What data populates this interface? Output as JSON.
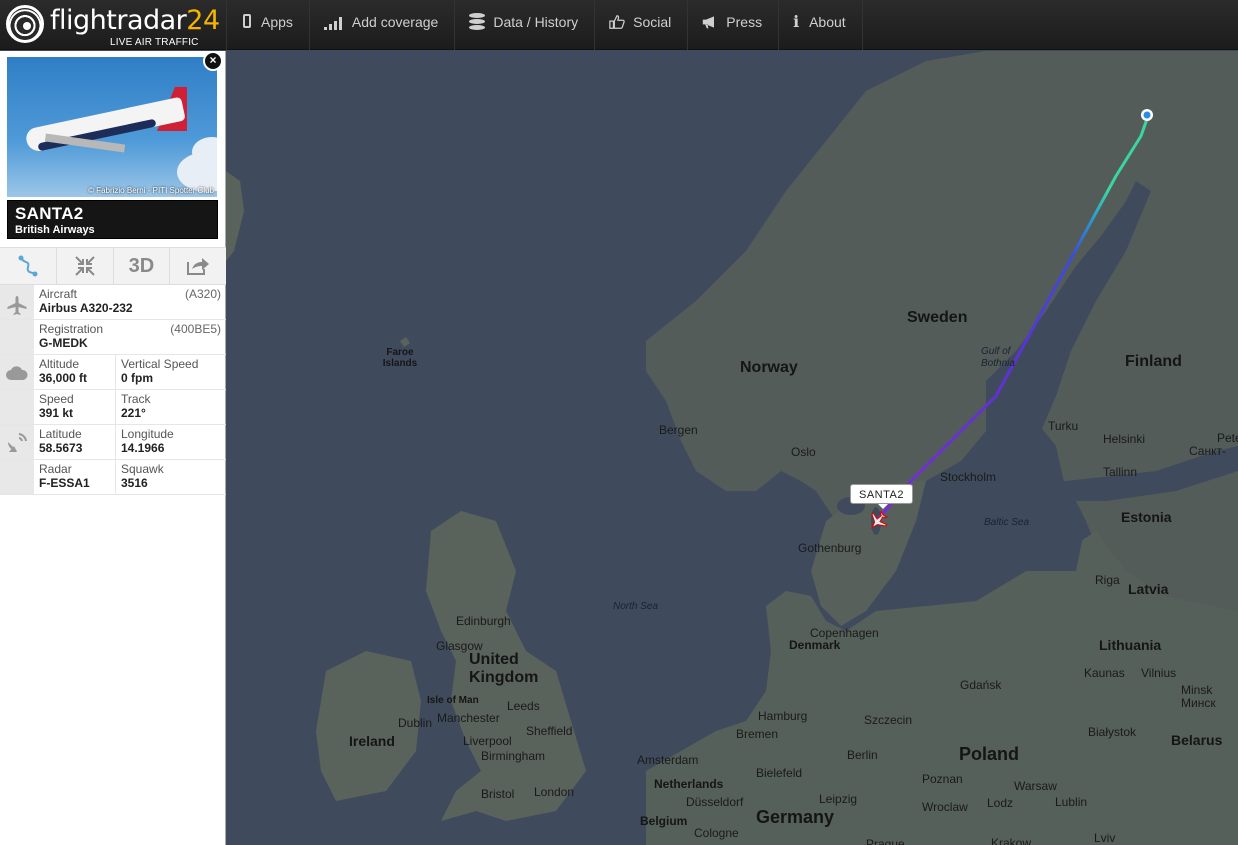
{
  "app": {
    "logo_text_main": "flightradar",
    "logo_text_accent": "24",
    "logo_sub": "LIVE AIR TRAFFIC"
  },
  "nav": [
    {
      "label": "Apps",
      "icon": "phone-icon"
    },
    {
      "label": "Add coverage",
      "icon": "signal-bars-icon"
    },
    {
      "label": "Data / History",
      "icon": "database-icon"
    },
    {
      "label": "Social",
      "icon": "thumbs-up-icon"
    },
    {
      "label": "Press",
      "icon": "megaphone-icon"
    },
    {
      "label": "About",
      "icon": "info-icon"
    }
  ],
  "flight": {
    "photo_credit": "© Fabrizio Berni - PITI Spotter Club",
    "callsign": "SANTA2",
    "airline": "British Airways",
    "tools": {
      "route": "route-icon",
      "collapse": "compress-icon",
      "three_d": "3D",
      "share": "share-icon"
    },
    "aircraft_label": "Aircraft",
    "aircraft_value": "Airbus A320-232",
    "aircraft_code": "(A320)",
    "registration_label": "Registration",
    "registration_value": "G-MEDK",
    "registration_code": "(400BE5)",
    "altitude_label": "Altitude",
    "altitude_value": "36,000 ft",
    "vspeed_label": "Vertical Speed",
    "vspeed_value": "0 fpm",
    "speed_label": "Speed",
    "speed_value": "391 kt",
    "track_label": "Track",
    "track_value": "221°",
    "latitude_label": "Latitude",
    "latitude_value": "58.5673",
    "longitude_label": "Longitude",
    "longitude_value": "14.1966",
    "radar_label": "Radar",
    "radar_value": "F-ESSA1",
    "squawk_label": "Squawk",
    "squawk_value": "3516"
  },
  "map": {
    "flight_tag": "SANTA2",
    "countries": [
      "Sweden",
      "Norway",
      "Finland",
      "Estonia",
      "Latvia",
      "Lithuania",
      "Denmark",
      "United Kingdom",
      "Ireland",
      "Poland",
      "Germany",
      "Belarus",
      "Belgium",
      "Netherlands"
    ],
    "cities": [
      "Bergen",
      "Oslo",
      "Stockholm",
      "Turku",
      "Helsinki",
      "Tallinn",
      "Gothenburg",
      "Riga",
      "Copenhagen",
      "Kaunas",
      "Vilnius",
      "Edinburgh",
      "Glasgow",
      "Leeds",
      "Manchester",
      "Liverpool",
      "Sheffield",
      "Dublin",
      "Birmingham",
      "Bristol",
      "London",
      "Amsterdam",
      "Hamburg",
      "Bremen",
      "Bielefeld",
      "Berlin",
      "Szczecin",
      "Gdańsk",
      "Białystok",
      "Poznan",
      "Warsaw",
      "Wroclaw",
      "Lodz",
      "Lublin",
      "Leipzig",
      "Düsseldorf",
      "Cologne",
      "Minsk",
      "Минск",
      "Pete",
      "Санкт-",
      "Krakow",
      "Praque",
      "Lviv"
    ],
    "seas": [
      "Gulf of Bothnia",
      "Baltic Sea",
      "North Sea"
    ],
    "islands": [
      "Faroe Islands",
      "Isle of Man"
    ],
    "route_colors": [
      "#7a2cd8",
      "#5a33d6",
      "#3a4fd6",
      "#2aa0d0",
      "#39d6a0"
    ]
  }
}
